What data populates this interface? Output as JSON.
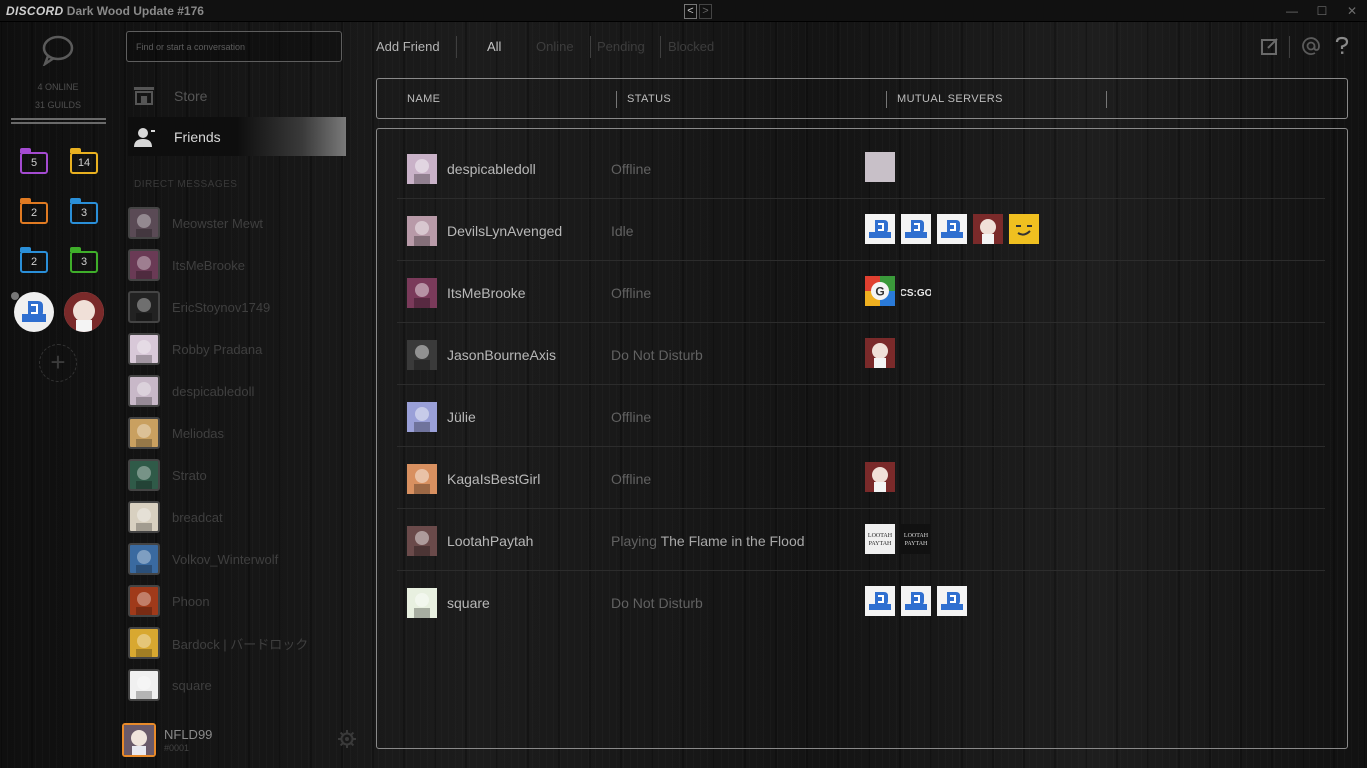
{
  "titlebar": {
    "brand": "DISCORD",
    "title": "Dark Wood Update #176",
    "back": "<",
    "forward": ">",
    "minimize": "—",
    "maximize": "☐",
    "close": "✕"
  },
  "guilds": {
    "online": "4 ONLINE",
    "guild_count": "31 GUILDS",
    "folders": [
      {
        "count": "5",
        "color": "#a44bd1"
      },
      {
        "count": "14",
        "color": "#e8b020"
      },
      {
        "count": "2",
        "color": "#e07a22"
      },
      {
        "count": "3",
        "color": "#2a8fd8"
      },
      {
        "count": "2",
        "color": "#2a8fd8"
      },
      {
        "count": "3",
        "color": "#3fae2a"
      }
    ],
    "add": "+"
  },
  "dms": {
    "search_placeholder": "Find or start a conversation",
    "store_label": "Store",
    "friends_label": "Friends",
    "header": "DIRECT MESSAGES",
    "items": [
      {
        "name": "Meowster Mewt",
        "color": "#5a4a55"
      },
      {
        "name": "ItsMeBrooke",
        "color": "#6a3a55"
      },
      {
        "name": "EricStoynov1749",
        "color": "#222"
      },
      {
        "name": "Robby Pradana",
        "color": "#d8c8d8"
      },
      {
        "name": "despicabledoll",
        "color": "#c8b8c8"
      },
      {
        "name": "Meliodas",
        "color": "#c9a060"
      },
      {
        "name": "Strato",
        "color": "#2f5a48"
      },
      {
        "name": "breadcat",
        "color": "#d8d0c0"
      },
      {
        "name": "Volkov_Winterwolf",
        "color": "#3a6aa0"
      },
      {
        "name": "Phoon",
        "color": "#a03a1a"
      },
      {
        "name": "Bardock | バードロック",
        "color": "#d8a830"
      },
      {
        "name": "square",
        "color": "#f0f0f0"
      }
    ],
    "user": {
      "name": "NFLD99",
      "tag": "#0001"
    }
  },
  "main": {
    "tabs": {
      "add_friend": "Add Friend",
      "all": "All",
      "online": "Online",
      "pending": "Pending",
      "blocked": "Blocked"
    },
    "columns": {
      "name": "NAME",
      "status": "STATUS",
      "mutual": "MUTUAL SERVERS"
    },
    "friends": [
      {
        "name": "despicabledoll",
        "status": "Offline",
        "game": "",
        "avatar_color": "#c9b2c8",
        "servers": [
          "#c8c0c8"
        ]
      },
      {
        "name": "DevilsLynAvenged",
        "status": "Idle",
        "game": "",
        "avatar_color": "#b89aa8",
        "servers": [
          "#2f6fd0",
          "#2f6fd0",
          "#2f6fd0",
          "#c89090",
          "#f0c020"
        ]
      },
      {
        "name": "ItsMeBrooke",
        "status": "Offline",
        "game": "",
        "avatar_color": "#7a3a5a",
        "servers": [
          "#e8b020",
          "#1a1a1a"
        ]
      },
      {
        "name": "JasonBourneAxis",
        "status": "Do Not Disturb",
        "game": "",
        "avatar_color": "#3a3a3a",
        "servers": [
          "#c89090"
        ]
      },
      {
        "name": "Jülie",
        "status": "Offline",
        "game": "",
        "avatar_color": "#9aa0d8",
        "servers": []
      },
      {
        "name": "KagaIsBestGirl",
        "status": "Offline",
        "game": "",
        "avatar_color": "#d89060",
        "servers": [
          "#c89090"
        ]
      },
      {
        "name": "LootahPaytah",
        "status": "Playing",
        "game": "The Flame in the Flood",
        "avatar_color": "#6a4a4a",
        "servers": [
          "#f0f0f0",
          "#111111"
        ]
      },
      {
        "name": "square",
        "status": "Do Not Disturb",
        "game": "",
        "avatar_color": "#e8f0e0",
        "servers": [
          "#2f6fd0",
          "#2f6fd0",
          "#2f6fd0"
        ]
      }
    ],
    "server_labels": {
      "csgo": "CS:GO",
      "lootah": "LOOTAH PAYTAH"
    }
  }
}
